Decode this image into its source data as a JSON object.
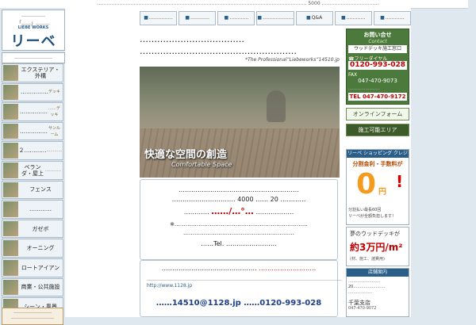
{
  "topbar": {
    "text": "…………………………………………………………………………………………………………………… 5000 ………………………………"
  },
  "logo": {
    "line1": "……………",
    "line2": "「……」………",
    "brand_en": "LIEBE WORKS",
    "brand_jp": "リーベ"
  },
  "nav": {
    "header": "……………………",
    "items": [
      {
        "label": "エクステリア・外構",
        "sub": ""
      },
      {
        "label": "……………",
        "sub": "デッキ"
      },
      {
        "label": "……………",
        "sub": "……デッキ"
      },
      {
        "label": "……………",
        "sub": "サンルーム"
      },
      {
        "label": "２…………",
        "sub": "…………"
      },
      {
        "label": "ベランダ・屋上",
        "sub": "…………"
      },
      {
        "label": "フェンス",
        "sub": ""
      },
      {
        "label": "…………",
        "sub": ""
      },
      {
        "label": "ガゼボ",
        "sub": ""
      },
      {
        "label": "オーニング",
        "sub": ""
      },
      {
        "label": "ロートアイアン",
        "sub": ""
      },
      {
        "label": "商業・公共施設",
        "sub": ""
      },
      {
        "label": "シーン・風景",
        "sub": ""
      }
    ],
    "footer_line1": "……………………",
    "footer_line2": "………………………"
  },
  "tabs": [
    {
      "icon": "■",
      "label": "……………"
    },
    {
      "icon": "■",
      "label": "…………"
    },
    {
      "icon": "■",
      "label": "…………"
    },
    {
      "icon": "■",
      "label": "……………………"
    },
    {
      "icon": "■",
      "label": "Q&A"
    },
    {
      "icon": "■",
      "label": "…………"
    },
    {
      "icon": "■",
      "label": "…………"
    }
  ],
  "main": {
    "headline1": "………………………………",
    "headline2": "………………………………………………",
    "professional": "*The Professional“Liebeworks”14510.jp",
    "hero_title": "快適な空間の創造",
    "hero_sub": "Comfortable Space",
    "box1": {
      "line1": "…………………………………………………",
      "line2_pre": "…………………………",
      "line2_num": "4000",
      "line2_mid": "……",
      "line2_num2": "20",
      "line2_post": "…………",
      "line3_pre": "…………",
      "price": "……/…°…",
      "line3_post": "………………",
      "line4": "※………………………………………………………………",
      "line5": "……………………………………………………",
      "line6_pre": "……Tel.",
      "line6_post": "……………………"
    },
    "box2": {
      "title_pre": "………………………………………",
      "title_red": "………………………",
      "body": "……………………………………………………………………………………………………………",
      "url": "http://www.1128.jp",
      "contact": "……14510@1128.jp ……0120-993-028"
    }
  },
  "right": {
    "contact_title": "お問い合せ",
    "contact_sub": "Contact",
    "contact_line": "ウッドデッキ施工窓口",
    "freedial_label": "フリーダイヤル",
    "freedial": "0120-993-028",
    "fax_label": "FAX",
    "fax": "047-470-9073",
    "office_line": "……………………",
    "tel": "TEL 047-470-9172",
    "online_form": "オンラインフォーム",
    "area": "施工可能エリア",
    "shop_header": "リーベ ショッピング クレジット",
    "shop_sub": "分割金利・手数料が",
    "zero": "0",
    "yen": "円",
    "shop_note1": "分割払い最長60回",
    "shop_note2": "リーベが全額負担します！",
    "dream_line1": "夢のウッドデッキが",
    "dream_line2": "約3万円/m²",
    "dream_note": "(材、施工、諸費用)",
    "store_header": "店舗案内",
    "store_p": "……………………\n20……………………\n………………",
    "branch": "千葉支店",
    "branch_sub": "047-470-9072"
  }
}
